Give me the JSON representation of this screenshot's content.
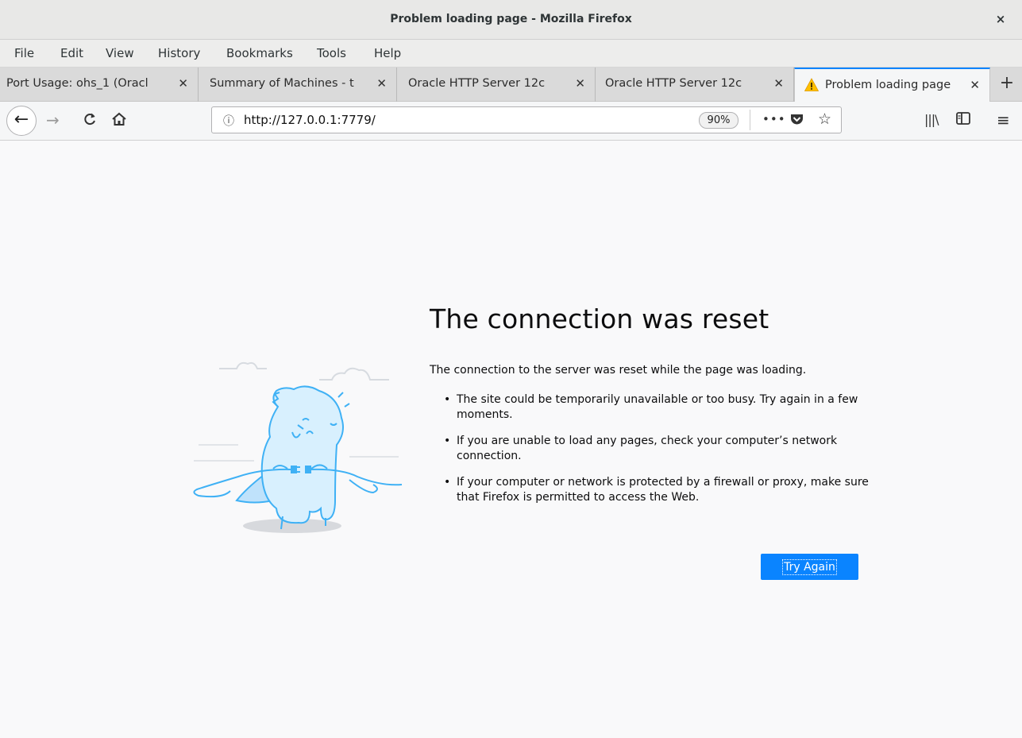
{
  "window": {
    "title": "Problem loading page - Mozilla Firefox",
    "close_glyph": "×"
  },
  "menu": {
    "file": "File",
    "edit": "Edit",
    "view": "View",
    "history": "History",
    "bookmarks": "Bookmarks",
    "tools": "Tools",
    "help": "Help"
  },
  "tabs": [
    {
      "label": "Port Usage: ohs_1 (Oracl"
    },
    {
      "label": "Summary of Machines - t"
    },
    {
      "label": "Oracle HTTP Server 12c"
    },
    {
      "label": "Oracle HTTP Server 12c"
    },
    {
      "label": "Problem loading page"
    }
  ],
  "nav": {
    "url": "http://127.0.0.1:7779/",
    "zoom": "90%"
  },
  "error": {
    "title": "The connection was reset",
    "description": "The connection to the server was reset while the page was loading.",
    "items": [
      "The site could be temporarily unavailable or too busy. Try again in a few moments.",
      "If you are unable to load any pages, check your computer’s network connection.",
      "If your computer or network is protected by a firewall or proxy, make sure that Firefox is permitted to access the Web."
    ],
    "button": "Try Again"
  },
  "colors": {
    "accent": "#0a84ff",
    "warning": "#ffbf00"
  },
  "icons": [
    "back-icon",
    "forward-icon",
    "reload-icon",
    "home-icon",
    "info-icon",
    "pocket-icon",
    "star-icon",
    "library-icon",
    "sidebar-icon",
    "hamburger-menu-icon",
    "warning-icon",
    "close-icon",
    "plus-icon"
  ]
}
